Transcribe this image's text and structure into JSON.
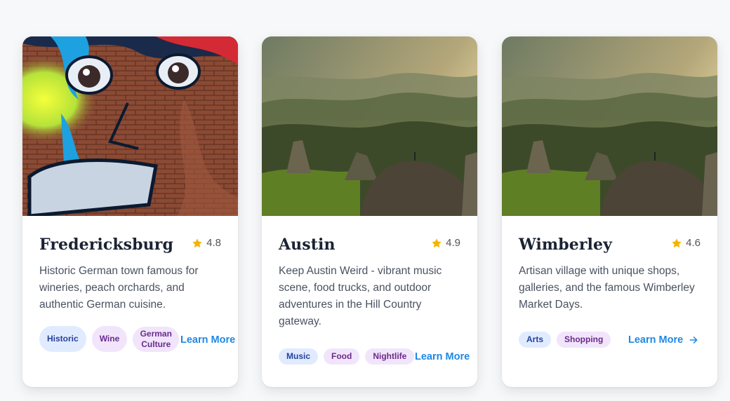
{
  "cards": [
    {
      "title": "Fredericksburg",
      "rating": "4.8",
      "description": "Historic German town famous for wineries, peach orchards, and authentic German cuisine.",
      "tags": [
        "Historic",
        "Wine",
        "German Culture"
      ],
      "learn_more": "Learn More",
      "image": "graffiti-mural"
    },
    {
      "title": "Austin",
      "rating": "4.9",
      "description": "Keep Austin Weird - vibrant music scene, food trucks, and outdoor adventures in the Hill Country gateway.",
      "tags": [
        "Music",
        "Food",
        "Nightlife"
      ],
      "learn_more": "Learn More",
      "image": "mountain-landscape"
    },
    {
      "title": "Wimberley",
      "rating": "4.6",
      "description": "Artisan village with unique shops, galleries, and the famous Wimberley Market Days.",
      "tags": [
        "Arts",
        "Shopping"
      ],
      "learn_more": "Learn More",
      "image": "mountain-landscape"
    }
  ],
  "colors": {
    "star": "#f5b400",
    "link": "#1e88e5",
    "tag_blue_bg": "#e1ebff",
    "tag_purple_bg": "#f1e5fb"
  },
  "icons": {
    "rating": "star-icon",
    "learn_more": "arrow-right-icon"
  }
}
